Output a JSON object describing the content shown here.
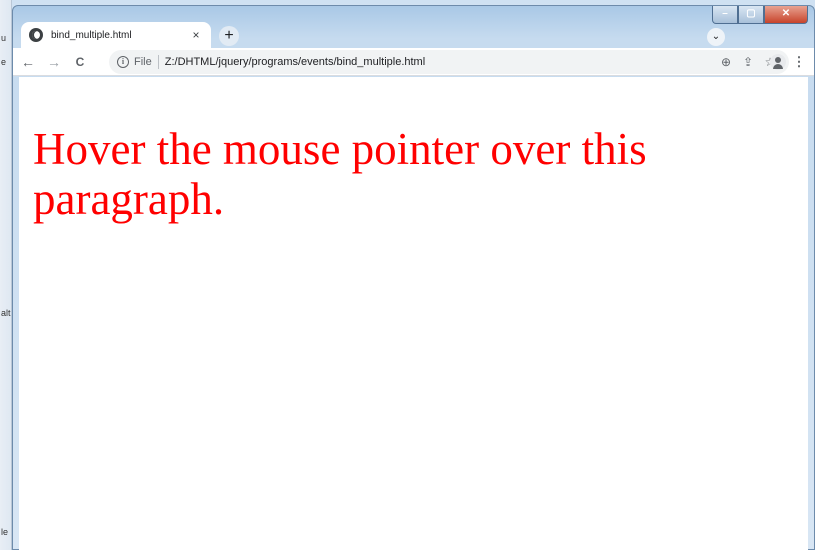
{
  "desktop": {
    "left_fragments": [
      "u",
      "e",
      "alt",
      "le"
    ]
  },
  "browser": {
    "tab": {
      "title": "bind_multiple.html",
      "close_glyph": "×"
    },
    "new_tab_glyph": "+",
    "tab_search_glyph": "⌄",
    "window_controls": {
      "minimize": "–",
      "maximize": "▢",
      "close": "✕"
    },
    "toolbar": {
      "back_glyph": "←",
      "forward_glyph": "→",
      "reload_glyph": "C",
      "info_glyph": "i",
      "scheme": "File",
      "url": "Z:/DHTML/jquery/programs/events/bind_multiple.html",
      "zoom_glyph": "⊕",
      "share_glyph": "⇪",
      "bookmark_glyph": "☆",
      "menu_glyph": "⋮"
    },
    "icons": [
      "globe-icon",
      "close-icon",
      "plus-icon",
      "chevron-down-icon",
      "back-arrow-icon",
      "forward-arrow-icon",
      "reload-icon",
      "info-icon",
      "zoom-icon",
      "share-icon",
      "star-icon",
      "profile-icon",
      "menu-icon"
    ]
  },
  "page": {
    "paragraph": "Hover the mouse pointer over this paragraph.",
    "text_color": "#ff0000"
  }
}
